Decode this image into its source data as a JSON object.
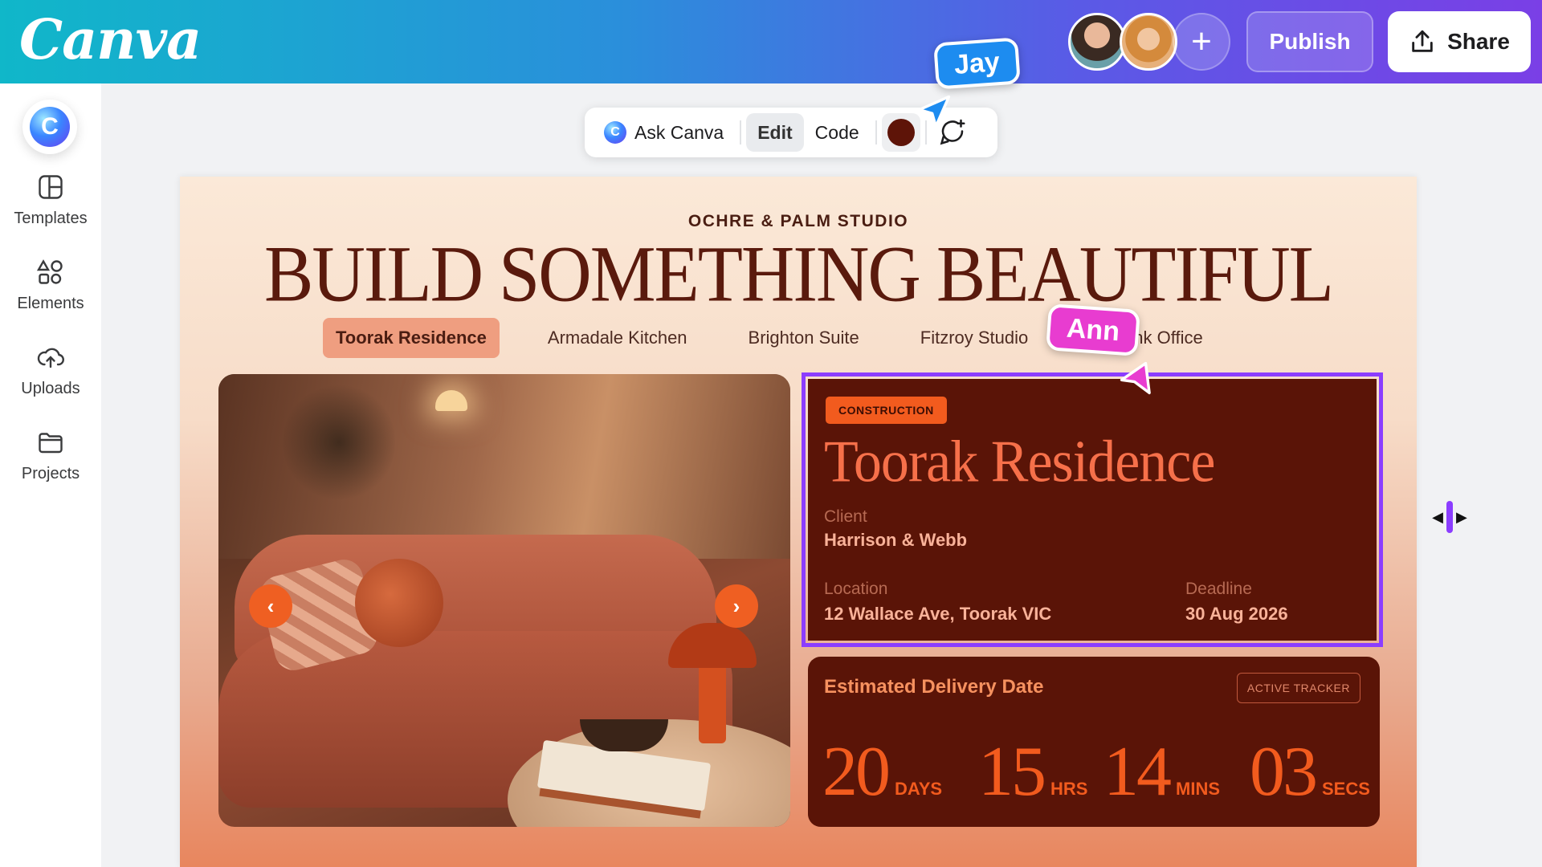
{
  "app": {
    "logo": "Canva"
  },
  "topbar": {
    "publish_label": "Publish",
    "share_label": "Share",
    "add_label": "+"
  },
  "sidebar": {
    "items": [
      {
        "label": "Templates",
        "icon": "templates-icon"
      },
      {
        "label": "Elements",
        "icon": "elements-icon"
      },
      {
        "label": "Uploads",
        "icon": "uploads-icon"
      },
      {
        "label": "Projects",
        "icon": "projects-icon"
      }
    ]
  },
  "toolbar": {
    "ask_label": "Ask Canva",
    "edit_label": "Edit",
    "code_label": "Code",
    "selected_color": "#5e1408"
  },
  "cursors": {
    "jay": "Jay",
    "ann": "Ann"
  },
  "design": {
    "studio": "OCHRE & PALM STUDIO",
    "headline": "BUILD SOMETHING BEAUTIFUL",
    "tabs": [
      "Toorak Residence",
      "Armadale Kitchen",
      "Brighton Suite",
      "Fitzroy Studio",
      "uthbank Office"
    ],
    "carousel": {
      "prev": "‹",
      "next": "›"
    },
    "project": {
      "badge": "CONSTRUCTION",
      "title": "Toorak Residence",
      "client_label": "Client",
      "client": "Harrison & Webb",
      "location_label": "Location",
      "location": "12 Wallace Ave, Toorak VIC",
      "deadline_label": "Deadline",
      "deadline": "30 Aug 2026"
    },
    "delivery": {
      "title": "Estimated Delivery Date",
      "tracker": "ACTIVE TRACKER",
      "days": "20",
      "days_unit": "DAYS",
      "hrs": "15",
      "hrs_unit": "HRS",
      "mins": "14",
      "mins_unit": "MINS",
      "secs": "03",
      "secs_unit": "SECS"
    }
  },
  "colors": {
    "accent": "#8b3dff",
    "card": "#5a1407",
    "orange": "#f25b1e"
  }
}
